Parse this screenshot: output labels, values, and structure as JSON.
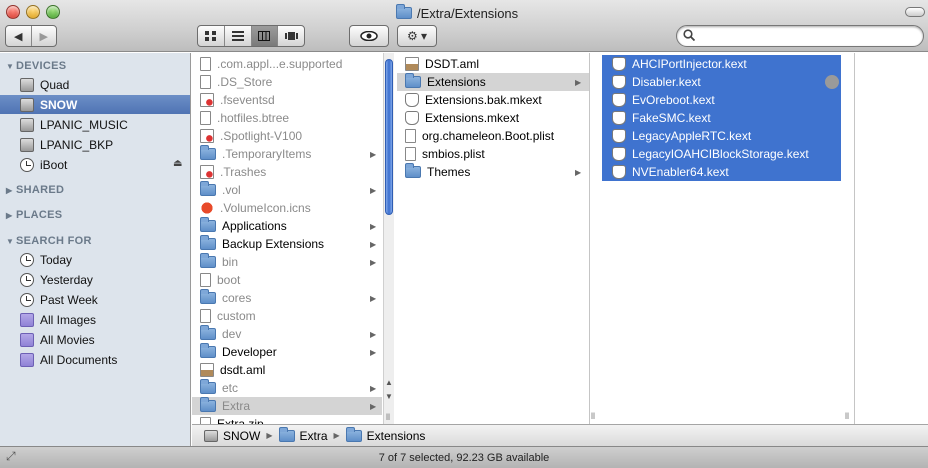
{
  "window": {
    "title": "/Extra/Extensions"
  },
  "toolbar": {
    "back": "◀",
    "forward": "▶",
    "quicklook": "👁",
    "action": "⚙ ▾"
  },
  "search": {
    "value": "",
    "placeholder": ""
  },
  "sidebar": {
    "devices": {
      "header": "DEVICES",
      "items": [
        {
          "label": "Quad",
          "icon": "hard-disk-icon"
        },
        {
          "label": "SNOW",
          "icon": "hard-disk-icon",
          "selected": true
        },
        {
          "label": "LPANIC_MUSIC",
          "icon": "usb-drive-icon"
        },
        {
          "label": "LPANIC_BKP",
          "icon": "usb-drive-icon"
        },
        {
          "label": "iBoot",
          "icon": "cd-icon"
        }
      ]
    },
    "shared": {
      "header": "SHARED"
    },
    "places": {
      "header": "PLACES"
    },
    "search_for": {
      "header": "SEARCH FOR",
      "items": [
        {
          "label": "Today",
          "icon": "clock-icon"
        },
        {
          "label": "Yesterday",
          "icon": "clock-icon"
        },
        {
          "label": "Past Week",
          "icon": "clock-icon"
        },
        {
          "label": "All Images",
          "icon": "smart-folder-icon"
        },
        {
          "label": "All Movies",
          "icon": "smart-folder-icon"
        },
        {
          "label": "All Documents",
          "icon": "smart-folder-icon"
        }
      ]
    }
  },
  "column1": {
    "items": [
      {
        "name": ".com.appl...e.supported",
        "kind": "doc",
        "dim": true
      },
      {
        "name": ".DS_Store",
        "kind": "doc",
        "dim": true
      },
      {
        "name": ".fseventsd",
        "kind": "noentry",
        "dim": true
      },
      {
        "name": ".hotfiles.btree",
        "kind": "doc",
        "dim": true
      },
      {
        "name": ".Spotlight-V100",
        "kind": "noentry",
        "dim": true
      },
      {
        "name": ".TemporaryItems",
        "kind": "folder",
        "dim": true,
        "arrow": true
      },
      {
        "name": ".Trashes",
        "kind": "noentry",
        "dim": true
      },
      {
        "name": ".vol",
        "kind": "folder",
        "dim": true,
        "arrow": true
      },
      {
        "name": ".VolumeIcon.icns",
        "kind": "apple",
        "dim": true
      },
      {
        "name": "Applications",
        "kind": "appfolder",
        "dim": false,
        "arrow": true
      },
      {
        "name": "Backup Extensions",
        "kind": "folder",
        "dim": false,
        "arrow": true
      },
      {
        "name": "bin",
        "kind": "folder",
        "dim": true,
        "arrow": true
      },
      {
        "name": "boot",
        "kind": "doc",
        "dim": true
      },
      {
        "name": "cores",
        "kind": "folder",
        "dim": true,
        "arrow": true
      },
      {
        "name": "custom",
        "kind": "doc",
        "dim": true
      },
      {
        "name": "dev",
        "kind": "folder",
        "dim": true,
        "arrow": true
      },
      {
        "name": "Developer",
        "kind": "appfolder",
        "dim": false,
        "arrow": true
      },
      {
        "name": "dsdt.aml",
        "kind": "aml",
        "dim": false
      },
      {
        "name": "etc",
        "kind": "folder",
        "dim": true,
        "arrow": true
      },
      {
        "name": "Extra",
        "kind": "folder",
        "dim": true,
        "arrow": true,
        "highlight": true
      },
      {
        "name": "Extra.zip",
        "kind": "doc",
        "dim": false
      }
    ]
  },
  "column2": {
    "items": [
      {
        "name": "DSDT.aml",
        "kind": "aml"
      },
      {
        "name": "Extensions",
        "kind": "folder",
        "arrow": true,
        "highlight": true
      },
      {
        "name": "Extensions.bak.mkext",
        "kind": "kext"
      },
      {
        "name": "Extensions.mkext",
        "kind": "kext"
      },
      {
        "name": "org.chameleon.Boot.plist",
        "kind": "doc"
      },
      {
        "name": "smbios.plist",
        "kind": "doc"
      },
      {
        "name": "Themes",
        "kind": "folder",
        "arrow": true
      }
    ]
  },
  "column3": {
    "items": [
      {
        "name": "AHCIPortInjector.kext"
      },
      {
        "name": "Disabler.kext"
      },
      {
        "name": "EvOreboot.kext"
      },
      {
        "name": "FakeSMC.kext"
      },
      {
        "name": "LegacyAppleRTC.kext"
      },
      {
        "name": "LegacyIOAHCIBlockStorage.kext"
      },
      {
        "name": "NVEnabler64.kext"
      }
    ]
  },
  "pathbar": {
    "segments": [
      "SNOW",
      "Extra",
      "Extensions"
    ]
  },
  "status": {
    "text": "7 of 7 selected, 92.23 GB available"
  },
  "colors": {
    "selection": "#3f73cf",
    "sidebar_bg": "#dde4ec",
    "sidebar_selected": "#5579b8"
  }
}
